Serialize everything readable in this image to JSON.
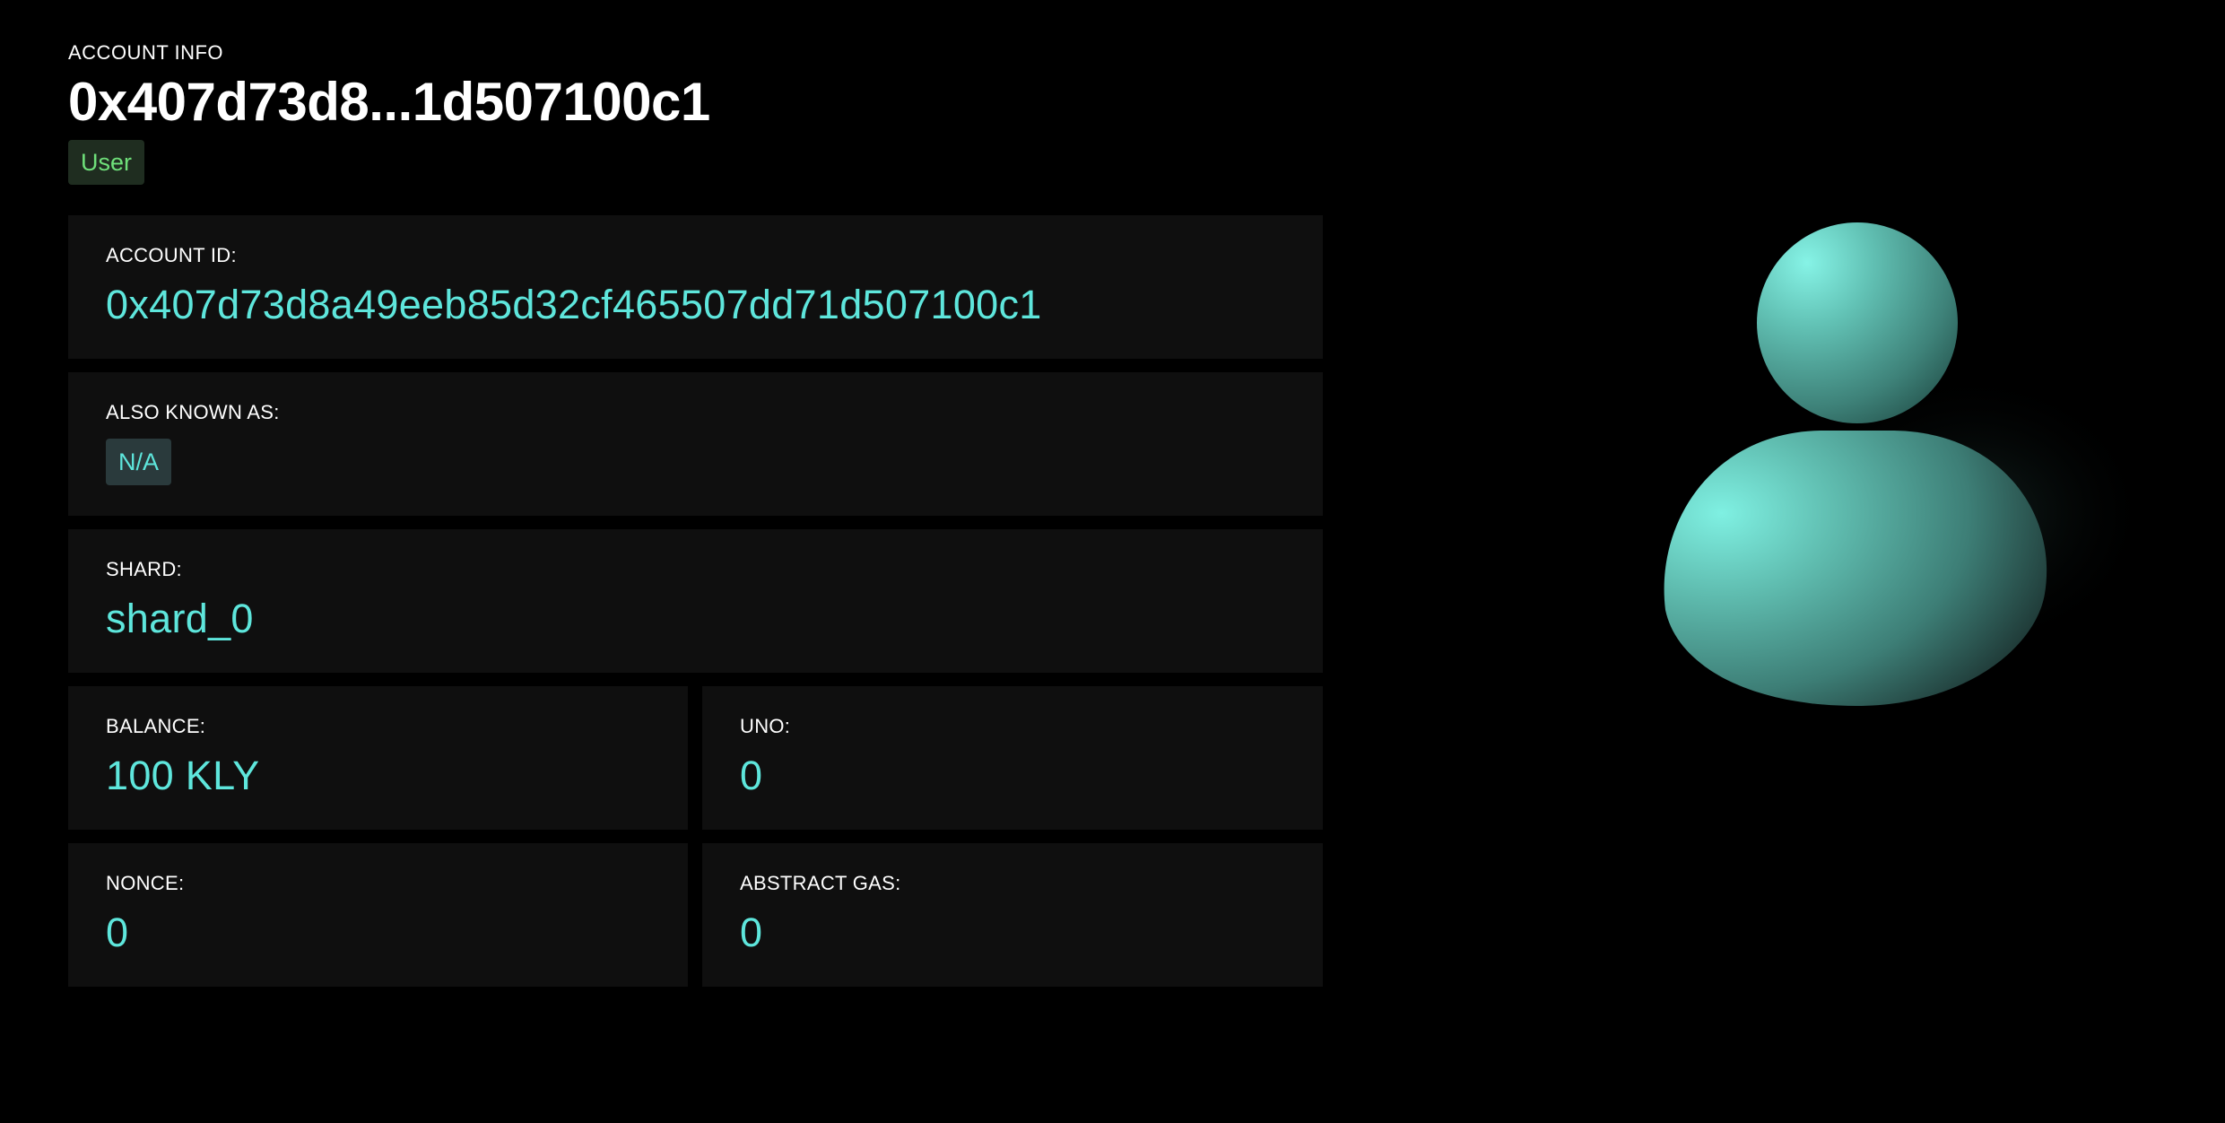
{
  "header": {
    "eyebrow": "ACCOUNT INFO",
    "title": "0x407d73d8...1d507100c1",
    "role_badge": "User"
  },
  "account_id": {
    "label": "ACCOUNT ID:",
    "value": "0x407d73d8a49eeb85d32cf465507dd71d507100c1"
  },
  "aliases": {
    "label": "ALSO KNOWN AS:",
    "value": "N/A"
  },
  "shard": {
    "label": "SHARD:",
    "value": "shard_0"
  },
  "balance": {
    "label": "BALANCE:",
    "value": "100 KLY"
  },
  "uno": {
    "label": "UNO:",
    "value": "0"
  },
  "nonce": {
    "label": "NONCE:",
    "value": "0"
  },
  "abstract_gas": {
    "label": "ABSTRACT GAS:",
    "value": "0"
  },
  "colors": {
    "background": "#000000",
    "panel": "#0f0f0f",
    "accent": "#5ee6dc",
    "role_badge_text": "#6fe07a",
    "role_badge_bg": "#1f2d20"
  },
  "icons": {
    "avatar": "user-avatar-icon"
  }
}
